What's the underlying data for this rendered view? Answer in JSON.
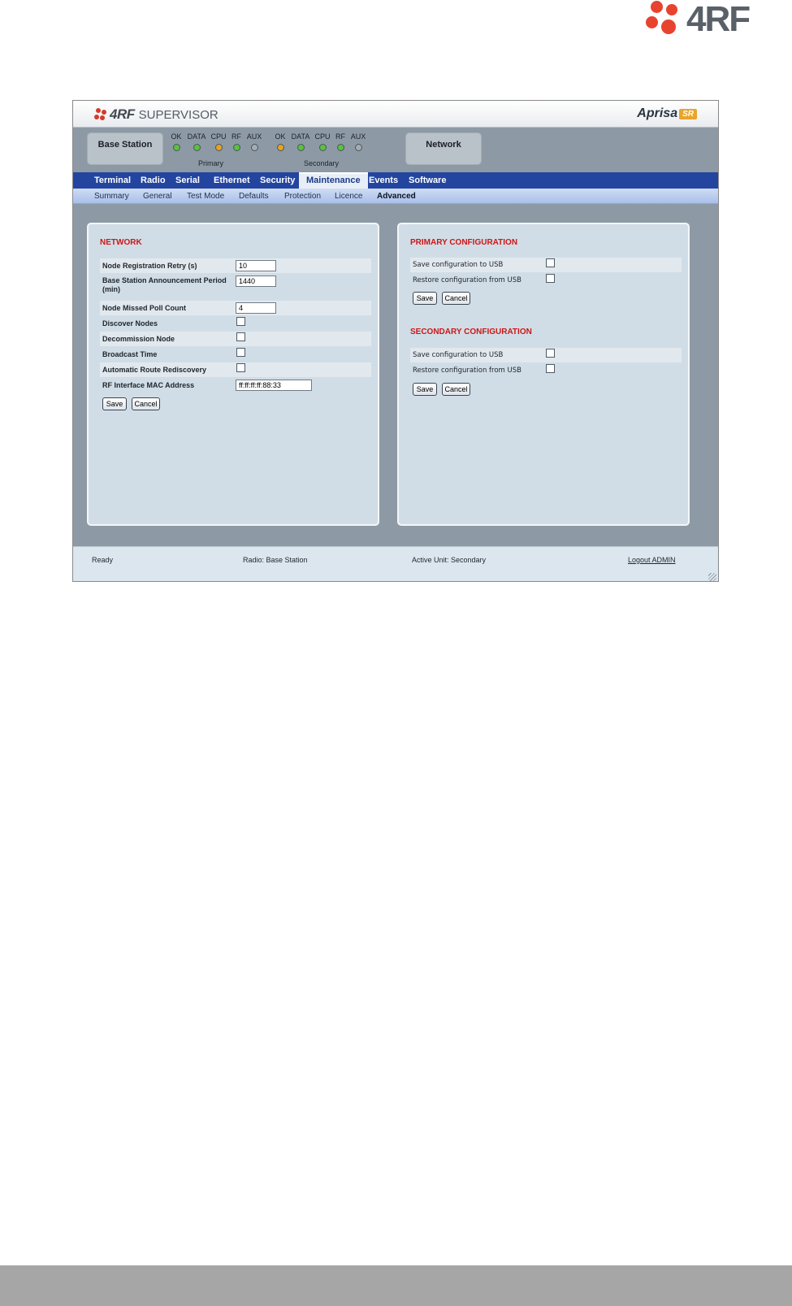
{
  "page_logo": {
    "text": "4RF"
  },
  "app": {
    "brand_4rf": "4RF",
    "brand_product": "SUPERVISOR",
    "right_brand": "Aprisa",
    "right_brand_badge": "SR"
  },
  "status": {
    "base_station_label": "Base Station",
    "network_label": "Network",
    "primary_label": "Primary",
    "secondary_label": "Secondary",
    "primary_leds": [
      {
        "label": "OK",
        "color": "#59c23a"
      },
      {
        "label": "DATA",
        "color": "#59c23a"
      },
      {
        "label": "CPU",
        "color": "#e8a320"
      },
      {
        "label": "RF",
        "color": "#59c23a"
      },
      {
        "label": "AUX",
        "color": "#a6acb2"
      }
    ],
    "secondary_leds": [
      {
        "label": "OK",
        "color": "#e8a320"
      },
      {
        "label": "DATA",
        "color": "#59c23a"
      },
      {
        "label": "CPU",
        "color": "#59c23a"
      },
      {
        "label": "RF",
        "color": "#59c23a"
      },
      {
        "label": "AUX",
        "color": "#a6acb2"
      }
    ]
  },
  "nav": {
    "tabs": [
      "Terminal",
      "Radio",
      "Serial",
      "Ethernet",
      "Security",
      "Maintenance",
      "Events",
      "Software"
    ],
    "active": "Maintenance"
  },
  "subnav": {
    "items": [
      "Summary",
      "General",
      "Test Mode",
      "Defaults",
      "Protection",
      "Licence",
      "Advanced"
    ],
    "active": "Advanced"
  },
  "network_panel": {
    "title": "NETWORK",
    "fields": {
      "node_registration_retry": {
        "label": "Node Registration Retry (s)",
        "value": "10"
      },
      "base_station_announcement": {
        "label": "Base Station Announcement Period",
        "label2": "(min)",
        "value": "1440"
      },
      "node_missed_poll": {
        "label": "Node Missed Poll Count",
        "value": "4"
      },
      "discover_nodes": {
        "label": "Discover Nodes"
      },
      "decommission_node": {
        "label": "Decommission Node"
      },
      "broadcast_time": {
        "label": "Broadcast Time"
      },
      "auto_route": {
        "label": "Automatic Route Rediscovery"
      },
      "rf_mac": {
        "label": "RF Interface MAC Address",
        "value": "ff:ff:ff:ff:88:33"
      }
    },
    "save_label": "Save",
    "cancel_label": "Cancel"
  },
  "primary_panel": {
    "title": "PRIMARY CONFIGURATION",
    "save_usb_label": "Save configuration to USB",
    "restore_usb_label": "Restore configuration from USB",
    "save_label": "Save",
    "cancel_label": "Cancel"
  },
  "secondary_panel": {
    "title": "SECONDARY CONFIGURATION",
    "save_usb_label": "Save configuration to USB",
    "restore_usb_label": "Restore configuration from USB",
    "save_label": "Save",
    "cancel_label": "Cancel"
  },
  "statusbar": {
    "state": "Ready",
    "radio": "Radio: Base Station",
    "active_unit": "Active Unit: Secondary",
    "logout": "Logout ADMIN"
  }
}
